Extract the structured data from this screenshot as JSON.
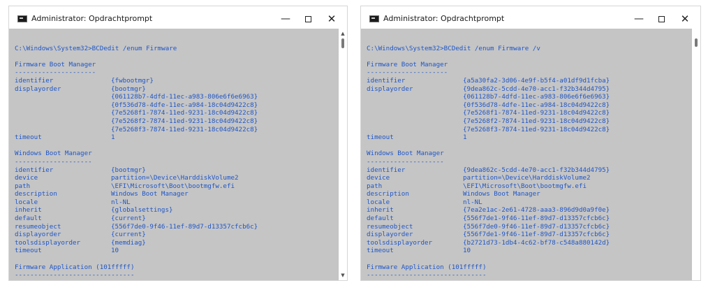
{
  "windows": [
    {
      "title": "Administrator: Opdrachtprompt",
      "command": "C:\\Windows\\System32>BCDedit /enum Firmware",
      "sections": [
        {
          "heading": "Firmware Boot Manager",
          "underline": "---------------------",
          "entries": [
            {
              "key": "identifier",
              "value": "{fwbootmgr}"
            },
            {
              "key": "displayorder",
              "value": "{bootmgr}"
            },
            {
              "key": "",
              "value": "{061128b7-4dfd-11ec-a983-806e6f6e6963}"
            },
            {
              "key": "",
              "value": "{0f536d78-4dfe-11ec-a984-18c04d9422c8}"
            },
            {
              "key": "",
              "value": "{7e5268f1-7874-11ed-9231-18c04d9422c8}"
            },
            {
              "key": "",
              "value": "{7e5268f2-7874-11ed-9231-18c04d9422c8}"
            },
            {
              "key": "",
              "value": "{7e5268f3-7874-11ed-9231-18c04d9422c8}"
            },
            {
              "key": "timeout",
              "value": "1"
            }
          ]
        },
        {
          "heading": "Windows Boot Manager",
          "underline": "--------------------",
          "entries": [
            {
              "key": "identifier",
              "value": "{bootmgr}"
            },
            {
              "key": "device",
              "value": "partition=\\Device\\HarddiskVolume2"
            },
            {
              "key": "path",
              "value": "\\EFI\\Microsoft\\Boot\\bootmgfw.efi"
            },
            {
              "key": "description",
              "value": "Windows Boot Manager"
            },
            {
              "key": "locale",
              "value": "nl-NL"
            },
            {
              "key": "inherit",
              "value": "{globalsettings}"
            },
            {
              "key": "default",
              "value": "{current}"
            },
            {
              "key": "resumeobject",
              "value": "{556f7de0-9f46-11ef-89d7-d13357cfcb6c}"
            },
            {
              "key": "displayorder",
              "value": "{current}"
            },
            {
              "key": "toolsdisplayorder",
              "value": "{memdiag}"
            },
            {
              "key": "timeout",
              "value": "10"
            }
          ]
        },
        {
          "heading": "Firmware Application (101fffff)",
          "underline": "-------------------------------",
          "entries": []
        }
      ]
    },
    {
      "title": "Administrator: Opdrachtprompt",
      "command": "C:\\Windows\\System32>BCDedit /enum Firmware /v",
      "sections": [
        {
          "heading": "Firmware Boot Manager",
          "underline": "---------------------",
          "entries": [
            {
              "key": "identifier",
              "value": "{a5a30fa2-3d06-4e9f-b5f4-a01df9d1fcba}"
            },
            {
              "key": "displayorder",
              "value": "{9dea862c-5cdd-4e70-acc1-f32b344d4795}"
            },
            {
              "key": "",
              "value": "{061128b7-4dfd-11ec-a983-806e6f6e6963}"
            },
            {
              "key": "",
              "value": "{0f536d78-4dfe-11ec-a984-18c04d9422c8}"
            },
            {
              "key": "",
              "value": "{7e5268f1-7874-11ed-9231-18c04d9422c8}"
            },
            {
              "key": "",
              "value": "{7e5268f2-7874-11ed-9231-18c04d9422c8}"
            },
            {
              "key": "",
              "value": "{7e5268f3-7874-11ed-9231-18c04d9422c8}"
            },
            {
              "key": "timeout",
              "value": "1"
            }
          ]
        },
        {
          "heading": "Windows Boot Manager",
          "underline": "--------------------",
          "entries": [
            {
              "key": "identifier",
              "value": "{9dea862c-5cdd-4e70-acc1-f32b344d4795}"
            },
            {
              "key": "device",
              "value": "partition=\\Device\\HarddiskVolume2"
            },
            {
              "key": "path",
              "value": "\\EFI\\Microsoft\\Boot\\bootmgfw.efi"
            },
            {
              "key": "description",
              "value": "Windows Boot Manager"
            },
            {
              "key": "locale",
              "value": "nl-NL"
            },
            {
              "key": "inherit",
              "value": "{7ea2e1ac-2e61-4728-aaa3-896d9d0a9f0e}"
            },
            {
              "key": "default",
              "value": "{556f7de1-9f46-11ef-89d7-d13357cfcb6c}"
            },
            {
              "key": "resumeobject",
              "value": "{556f7de0-9f46-11ef-89d7-d13357cfcb6c}"
            },
            {
              "key": "displayorder",
              "value": "{556f7de1-9f46-11ef-89d7-d13357cfcb6c}"
            },
            {
              "key": "toolsdisplayorder",
              "value": "{b2721d73-1db4-4c62-bf78-c548a880142d}"
            },
            {
              "key": "timeout",
              "value": "10"
            }
          ]
        },
        {
          "heading": "Firmware Application (101fffff)",
          "underline": "-------------------------------",
          "entries": []
        }
      ]
    }
  ],
  "icons": {
    "app": "console-icon",
    "minimize": "minimize-icon",
    "maximize": "maximize-icon",
    "close": "close-icon",
    "scroll_up": "arrow-up-icon",
    "scroll_down": "arrow-down-icon"
  },
  "colors": {
    "console_bg": "#c5c5c5",
    "console_text": "#1e56c8"
  }
}
